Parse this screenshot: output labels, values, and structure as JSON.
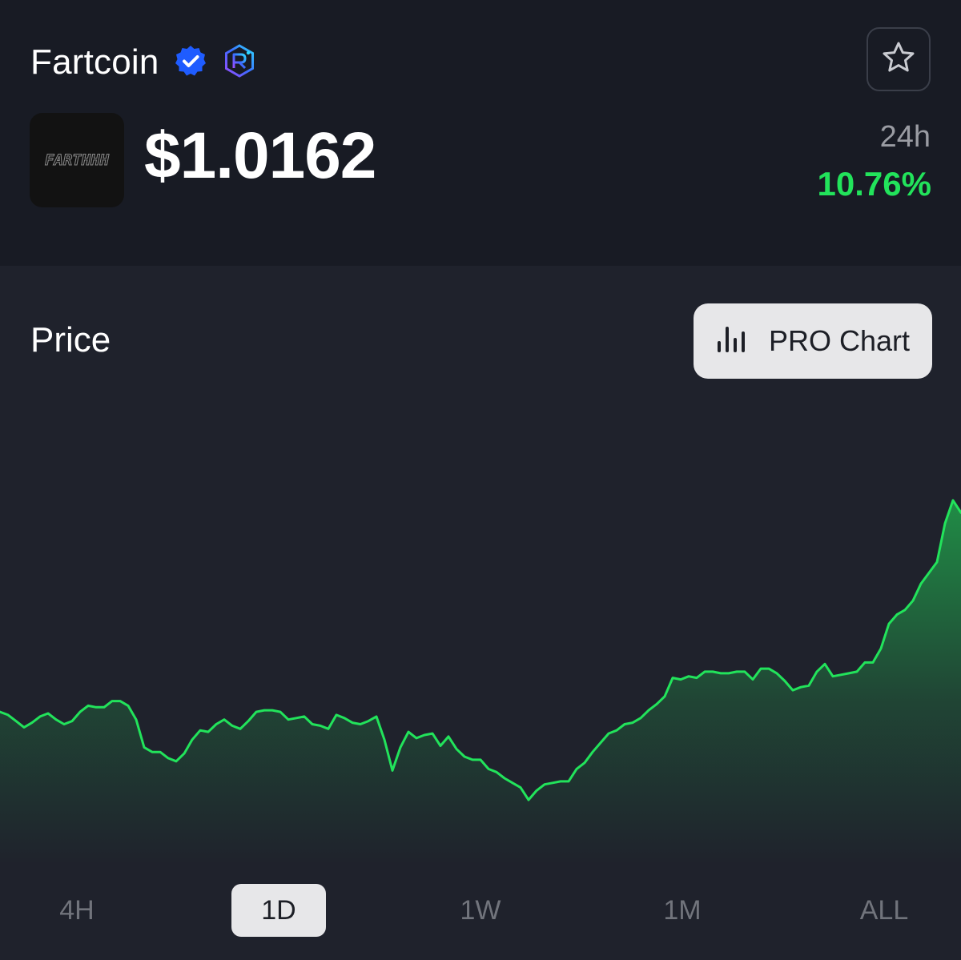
{
  "coin": {
    "name": "Fartcoin",
    "logo_text": "FARTHHH",
    "price": "$1.0162",
    "period_label": "24h",
    "change": "10.76%"
  },
  "icons": {
    "verified": "verified-badge-icon",
    "dex": "raydium-icon",
    "favorite": "star-icon",
    "pro_chart": "bar-chart-icon"
  },
  "colors": {
    "header_bg": "#181b24",
    "body_bg": "#1f222c",
    "positive": "#22e35b",
    "verified": "#1f5cff",
    "button_bg": "#e7e7e9"
  },
  "section": {
    "title": "Price",
    "pro_chart_label": "PRO Chart"
  },
  "tabs": [
    {
      "label": "4H",
      "active": false
    },
    {
      "label": "1D",
      "active": true
    },
    {
      "label": "1W",
      "active": false
    },
    {
      "label": "1M",
      "active": false
    },
    {
      "label": "ALL",
      "active": false
    }
  ],
  "chart_data": {
    "type": "area",
    "title": "",
    "xlabel": "",
    "ylabel": "",
    "grid": false,
    "x": [
      0,
      1,
      2,
      3,
      4,
      5,
      6,
      7,
      8,
      9,
      10,
      11,
      12,
      13,
      14,
      15,
      16,
      17,
      18,
      19,
      20,
      21,
      22,
      23,
      24,
      25,
      26,
      27,
      28,
      29,
      30,
      31,
      32,
      33,
      34,
      35,
      36,
      37,
      38,
      39,
      40,
      41,
      42,
      43,
      44,
      45,
      46,
      47,
      48,
      49,
      50,
      51,
      52,
      53,
      54,
      55,
      56,
      57,
      58,
      59,
      60,
      61,
      62,
      63,
      64,
      65,
      66,
      67,
      68,
      69,
      70,
      71,
      72,
      73,
      74,
      75,
      76,
      77,
      78,
      79,
      80,
      81,
      82,
      83,
      84,
      85,
      86,
      87,
      88,
      89,
      90,
      91,
      92,
      93,
      94,
      95,
      96,
      97,
      98,
      99,
      100,
      101,
      102,
      103,
      104,
      105,
      106,
      107,
      108,
      109,
      110,
      111,
      112,
      113,
      114,
      115,
      116,
      117,
      118,
      119,
      120
    ],
    "values": [
      0.879,
      0.877,
      0.873,
      0.869,
      0.872,
      0.876,
      0.878,
      0.874,
      0.871,
      0.873,
      0.879,
      0.883,
      0.882,
      0.882,
      0.886,
      0.886,
      0.883,
      0.874,
      0.856,
      0.853,
      0.853,
      0.849,
      0.847,
      0.852,
      0.861,
      0.867,
      0.866,
      0.871,
      0.874,
      0.87,
      0.868,
      0.873,
      0.879,
      0.88,
      0.88,
      0.879,
      0.874,
      0.875,
      0.876,
      0.871,
      0.87,
      0.868,
      0.877,
      0.875,
      0.872,
      0.871,
      0.873,
      0.876,
      0.861,
      0.841,
      0.856,
      0.866,
      0.862,
      0.864,
      0.865,
      0.857,
      0.863,
      0.855,
      0.85,
      0.848,
      0.848,
      0.842,
      0.84,
      0.836,
      0.833,
      0.83,
      0.822,
      0.828,
      0.832,
      0.833,
      0.834,
      0.834,
      0.842,
      0.846,
      0.853,
      0.859,
      0.865,
      0.867,
      0.871,
      0.872,
      0.875,
      0.88,
      0.884,
      0.889,
      0.901,
      0.9,
      0.902,
      0.901,
      0.905,
      0.905,
      0.904,
      0.904,
      0.905,
      0.905,
      0.9,
      0.907,
      0.907,
      0.904,
      0.899,
      0.893,
      0.895,
      0.896,
      0.905,
      0.91,
      0.902,
      0.903,
      0.904,
      0.905,
      0.911,
      0.911,
      0.92,
      0.936,
      0.942,
      0.945,
      0.951,
      0.962,
      0.969,
      0.976,
      1.001,
      1.016,
      1.008
    ],
    "ylim": [
      0.78,
      1.06
    ],
    "line_color": "#22e35b",
    "fill": "gradient green to transparent"
  }
}
